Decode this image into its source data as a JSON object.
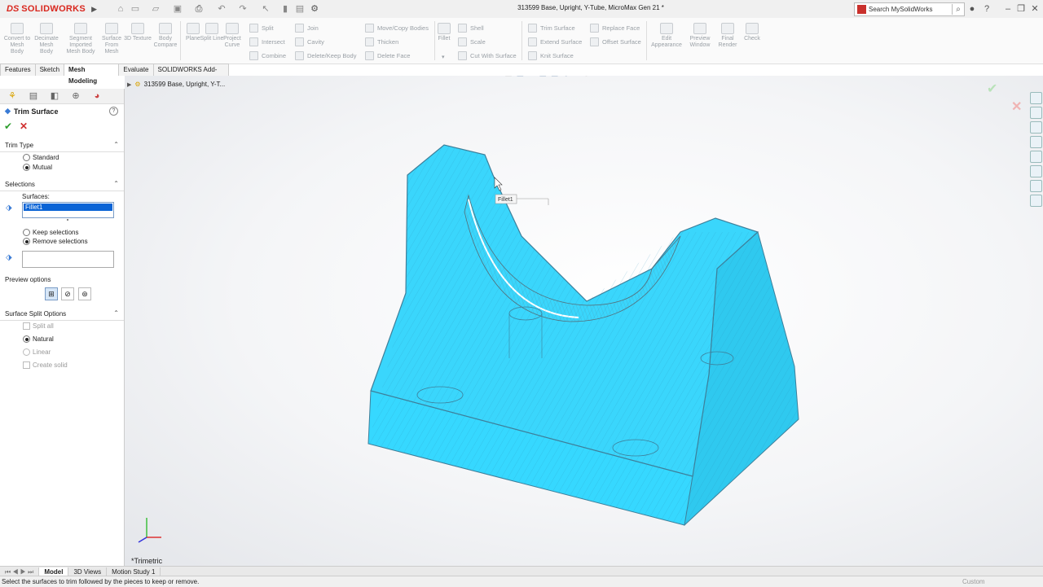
{
  "app": {
    "logo_ds": "DS",
    "logo_name": "SOLIDWORKS",
    "document_title": "313599 Base, Upright, Y-Tube, MicroMax Gen 21 *",
    "search_placeholder": "Search MySolidWorks"
  },
  "ribbon": {
    "mesh_buttons": [
      {
        "label": "Convert to Mesh Body"
      },
      {
        "label": "Decimate Mesh Body"
      },
      {
        "label": "Segment Imported Mesh Body"
      },
      {
        "label": "Surface From Mesh"
      },
      {
        "label": "3D Texture"
      },
      {
        "label": "Body Compare"
      },
      {
        "label": "Plane"
      },
      {
        "label": "Split Line"
      },
      {
        "label": "Project Curve"
      }
    ],
    "small_col1": [
      "Split",
      "Intersect",
      "Combine"
    ],
    "small_col2": [
      "Join",
      "Cavity",
      "Delete/Keep Body"
    ],
    "small_col3": [
      "Move/Copy Bodies",
      "Thicken",
      "Delete Face"
    ],
    "fillet_label": "Fillet",
    "small_col4": [
      "Shell",
      "Scale",
      "Cut With Surface"
    ],
    "small_col5": [
      "Trim Surface",
      "Extend Surface",
      "Knit Surface"
    ],
    "small_col6": [
      "Replace Face",
      "Offset Surface"
    ],
    "right_buttons": [
      {
        "label": "Edit Appearance"
      },
      {
        "label": "Preview Window"
      },
      {
        "label": "Final Render"
      },
      {
        "label": "Check"
      }
    ]
  },
  "tabs": [
    "Features",
    "Sketch",
    "Mesh Modeling",
    "Evaluate",
    "SOLIDWORKS Add-Ins"
  ],
  "active_tab": "Mesh Modeling",
  "tree": {
    "root_label": "313599 Base, Upright, Y-T..."
  },
  "property_manager": {
    "title": "Trim Surface",
    "trim_type": {
      "header": "Trim Type",
      "options": [
        "Standard",
        "Mutual"
      ],
      "selected": "Mutual"
    },
    "selections": {
      "header": "Selections",
      "surfaces_label": "Surfaces:",
      "surfaces_value": "Fillet1",
      "keep_label": "Keep selections",
      "remove_label": "Remove selections",
      "selected": "Remove selections"
    },
    "preview": {
      "header": "Preview options"
    },
    "split": {
      "header": "Surface Split Options",
      "split_all": "Split all",
      "natural": "Natural",
      "linear": "Linear",
      "create_solid": "Create solid",
      "selected": "Natural"
    }
  },
  "viewport": {
    "tooltip": "Fillet1",
    "view_label": "*Trimetric",
    "model_color": "#33d6ff"
  },
  "bottom_tabs": [
    "Model",
    "3D Views",
    "Motion Study 1"
  ],
  "status": {
    "message": "Select the surfaces to trim followed by the pieces to keep or remove.",
    "custom": "Custom"
  }
}
